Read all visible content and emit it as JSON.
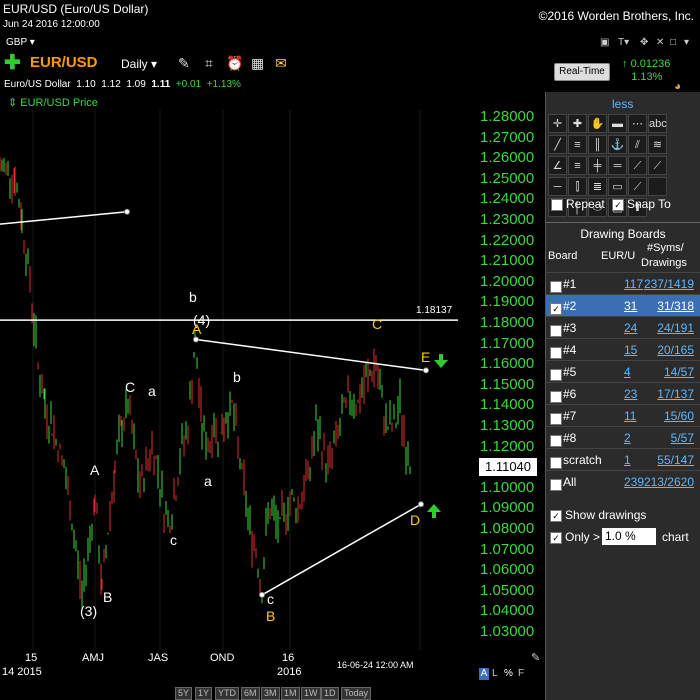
{
  "window": {
    "title": "EUR/USD (Euro/US Dollar)",
    "datetime": "Jun 24 2016 12:00:00",
    "copyright": "©2016 Worden Brothers, Inc."
  },
  "currency": "GBP",
  "toolbar": {
    "symbol": "EUR/USD",
    "period": "Daily",
    "icons": [
      "wrench-icon",
      "ruler-icon",
      "alarm-clock-icon",
      "calculator-icon",
      "note-icon"
    ]
  },
  "quote": {
    "name": "Euro/US Dollar",
    "open": "1.10",
    "high": "1.12",
    "low": "1.09",
    "close": "1.11",
    "change": "+0.01",
    "change_pct": "+1.13%"
  },
  "price_label": "EUR/USD Price",
  "realtime": {
    "button": "Real-Time",
    "value": "0.01236",
    "pct": "1.13%"
  },
  "panel": {
    "less": "less",
    "repeat": "Repeat",
    "snap_to": "Snap To",
    "drawing_boards_title": "Drawing Boards",
    "headers": {
      "board": "Board",
      "eur": "EUR/U",
      "syms": "#Syms/",
      "drawings": "Drawings"
    },
    "boards": [
      {
        "name": "#1",
        "eur": "117",
        "syms": "237/1419",
        "checked": false,
        "selected": false
      },
      {
        "name": "#2",
        "eur": "31",
        "syms": "31/318",
        "checked": true,
        "selected": true
      },
      {
        "name": "#3",
        "eur": "24",
        "syms": "24/191",
        "checked": false,
        "selected": false
      },
      {
        "name": "#4",
        "eur": "15",
        "syms": "20/165",
        "checked": false,
        "selected": false
      },
      {
        "name": "#5",
        "eur": "4",
        "syms": "14/57",
        "checked": false,
        "selected": false
      },
      {
        "name": "#6",
        "eur": "23",
        "syms": "17/137",
        "checked": false,
        "selected": false
      },
      {
        "name": "#7",
        "eur": "11",
        "syms": "15/60",
        "checked": false,
        "selected": false
      },
      {
        "name": "#8",
        "eur": "2",
        "syms": "5/57",
        "checked": false,
        "selected": false
      },
      {
        "name": "scratch",
        "eur": "1",
        "syms": "55/147",
        "checked": false,
        "selected": false
      },
      {
        "name": "All",
        "eur": "239",
        "syms": "213/2620",
        "checked": false,
        "selected": false
      }
    ],
    "show_drawings": "Show drawings",
    "only_label": "Only >",
    "only_value": "1.0 %",
    "chart_suffix": "chart"
  },
  "chart_data": {
    "type": "candlestick",
    "y_ticks": [
      "1.28000",
      "1.27000",
      "1.26000",
      "1.25000",
      "1.24000",
      "1.23000",
      "1.22000",
      "1.21000",
      "1.20000",
      "1.19000",
      "1.18000",
      "1.17000",
      "1.16000",
      "1.15000",
      "1.14000",
      "1.13000",
      "1.12000",
      "1.11000",
      "1.10000",
      "1.09000",
      "1.08000",
      "1.07000",
      "1.06000",
      "1.05000",
      "1.04000",
      "1.03000"
    ],
    "ylim": [
      1.025,
      1.285
    ],
    "x_ticks": [
      "15",
      "AMJ",
      "JAS",
      "OND",
      "16",
      "2016"
    ],
    "x_tick_first_extra": "14 2015",
    "cursor_date": "16-06-24 12:00 AM",
    "current_price": "1.11040",
    "hline_label": "1.18137",
    "annotations": [
      {
        "text": "(3)",
        "color": "#ffffff"
      },
      {
        "text": "A",
        "color": "#ffffff"
      },
      {
        "text": "B",
        "color": "#ffffff"
      },
      {
        "text": "C",
        "color": "#ffffff"
      },
      {
        "text": "a",
        "color": "#ffffff"
      },
      {
        "text": "b",
        "color": "#ffffff"
      },
      {
        "text": "(4)",
        "color": "#ffffff"
      },
      {
        "text": "A",
        "color": "#ffcc00"
      },
      {
        "text": "c",
        "color": "#ffffff"
      },
      {
        "text": "a",
        "color": "#ffffff"
      },
      {
        "text": "b",
        "color": "#ffffff"
      },
      {
        "text": "c",
        "color": "#ffffff"
      },
      {
        "text": "B",
        "color": "#ffcc00"
      },
      {
        "text": "C",
        "color": "#ffcc00"
      },
      {
        "text": "E",
        "color": "#ffcc00"
      },
      {
        "text": "D",
        "color": "#ffcc00"
      }
    ],
    "colors": {
      "up": "#3cd83c",
      "down": "#e03030",
      "axis": "#3cd83c",
      "trendline": "#ffffff"
    }
  },
  "axis_mode": {
    "a": "A",
    "l": "L",
    "pct": "%",
    "f": "F"
  },
  "timeframes": [
    "5Y",
    "1Y",
    "YTD",
    "6M",
    "3M",
    "1M",
    "1W",
    "1D",
    "Today"
  ]
}
